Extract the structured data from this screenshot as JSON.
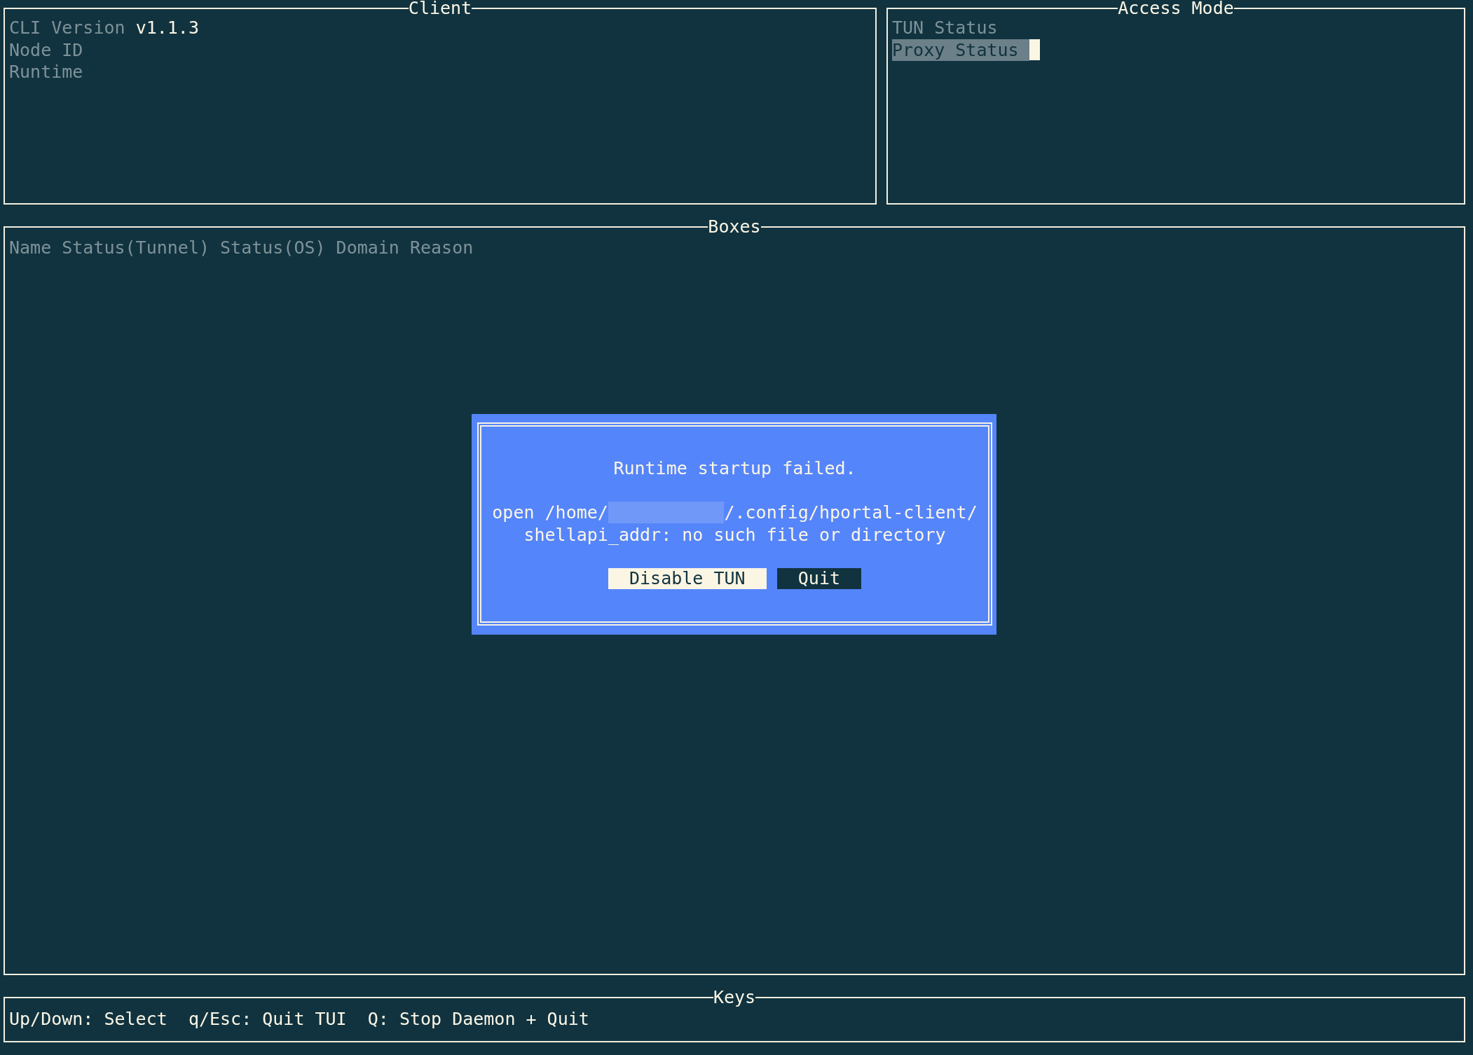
{
  "client": {
    "title": "Client",
    "rows": [
      {
        "label": "CLI Version",
        "value": "v1.1.3"
      },
      {
        "label": "Node ID"
      },
      {
        "label": "Runtime"
      }
    ]
  },
  "access_mode": {
    "title": "Access Mode",
    "items": [
      {
        "label": "TUN Status",
        "selected": false
      },
      {
        "label": "Proxy Status",
        "selected": true
      }
    ]
  },
  "boxes": {
    "title": "Boxes",
    "columns": [
      "Name",
      "Status(Tunnel)",
      "Status(OS)",
      "Domain",
      "Reason"
    ]
  },
  "dialog": {
    "title": "Runtime startup failed.",
    "message_lines": [
      {
        "segments": [
          {
            "kind": "text",
            "text": "open /home/"
          },
          {
            "kind": "redacted"
          },
          {
            "kind": "text",
            "text": "/.config/hportal-client/"
          }
        ]
      },
      {
        "segments": [
          {
            "kind": "text",
            "text": "shellapi_addr: no such file or directory"
          }
        ]
      }
    ],
    "buttons": [
      {
        "label": "Disable TUN",
        "selected": true
      },
      {
        "label": "Quit",
        "selected": false
      }
    ]
  },
  "keys": {
    "title": "Keys",
    "items": [
      "Up/Down: Select",
      "q/Esc: Quit TUI",
      "Q: Stop Daemon + Quit"
    ]
  }
}
